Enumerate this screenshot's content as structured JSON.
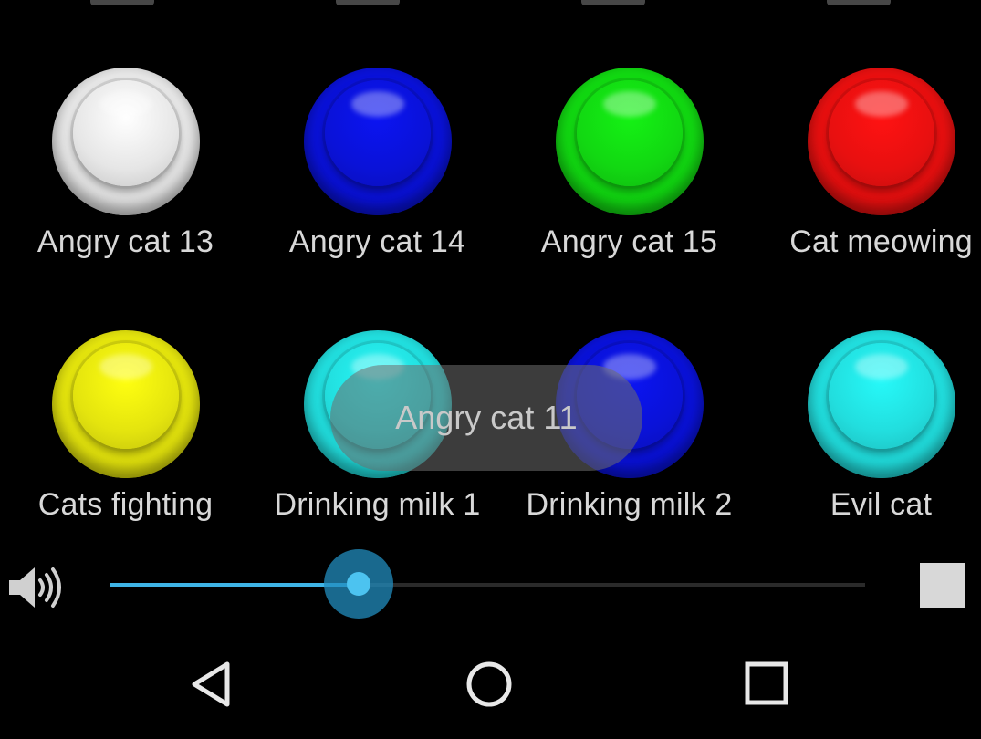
{
  "buttons": [
    {
      "label": "Angry cat 13",
      "color": "#e6e6e6"
    },
    {
      "label": "Angry cat 14",
      "color": "#0a12d8"
    },
    {
      "label": "Angry cat 15",
      "color": "#12d812"
    },
    {
      "label": "Cat meowing",
      "color": "#e81010"
    },
    {
      "label": "Cats fighting",
      "color": "#e4e40e"
    },
    {
      "label": "Drinking milk 1",
      "color": "#22dede"
    },
    {
      "label": "Drinking milk 2",
      "color": "#0a12d8"
    },
    {
      "label": "Evil cat",
      "color": "#22dede"
    }
  ],
  "toast": {
    "text": "Angry cat 11"
  },
  "volume": {
    "level": 0.33,
    "accent": "#3fb4e6"
  },
  "icons": {
    "volume": "speaker-icon",
    "stop": "stop-icon",
    "back": "back-triangle-icon",
    "home": "home-circle-icon",
    "recents": "recents-square-icon"
  }
}
